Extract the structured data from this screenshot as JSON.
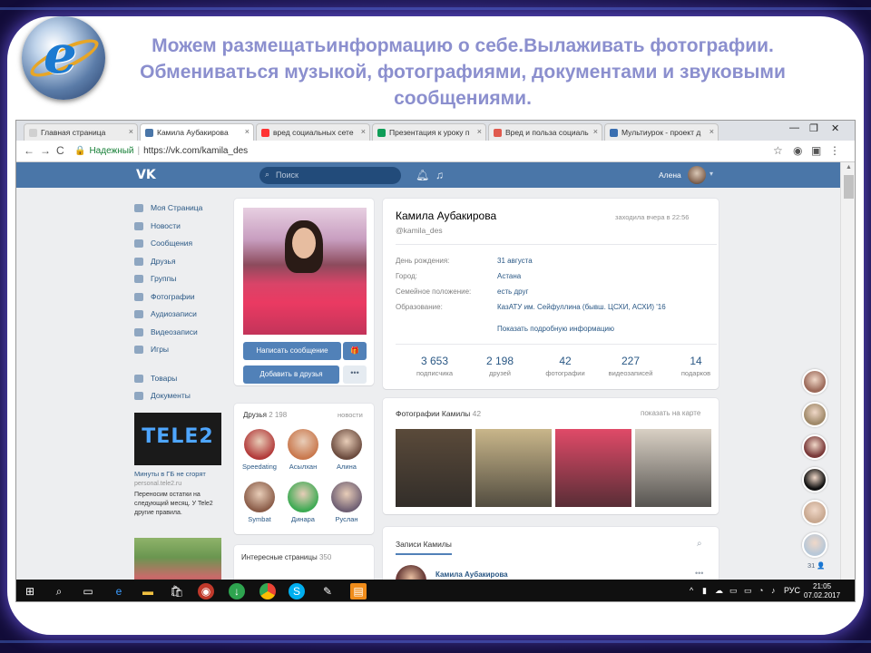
{
  "slide": {
    "title": "Можем размещатьинформацию о себе.Вылаживать фотографии. Обмениваться музыкой, фотографиями, документами и звуковыми сообщениями."
  },
  "browser": {
    "tabs": [
      {
        "label": "Главная страница",
        "active": false,
        "color": "#d0d0d0"
      },
      {
        "label": "Камила Аубакирова",
        "active": true,
        "color": "#4a76a8"
      },
      {
        "label": "вред социальных сете",
        "active": false,
        "color": "#f33"
      },
      {
        "label": "Презентация к уроку п",
        "active": false,
        "color": "#0f9d58"
      },
      {
        "label": "Вред и польза социаль",
        "active": false,
        "color": "#e05a4e"
      },
      {
        "label": "Мультиурок - проект д",
        "active": false,
        "color": "#3a6fb0"
      }
    ],
    "tab_close": "×",
    "window_controls": [
      "—",
      "❐",
      "✕"
    ],
    "nav": {
      "back": "←",
      "forward": "→",
      "reload": "C"
    },
    "secure_label": "Надежный",
    "url": "https://vk.com/kamila_des"
  },
  "vk": {
    "logo": "VK",
    "search_placeholder": "Поиск",
    "user_name": "Алена",
    "menu": [
      "Моя Страница",
      "Новости",
      "Сообщения",
      "Друзья",
      "Группы",
      "Фотографии",
      "Аудиозаписи",
      "Видеозаписи",
      "Игры"
    ],
    "menu2": [
      "Товары",
      "Документы"
    ],
    "ad": {
      "image_text": "TELE2",
      "title": "Минуты в ГБ не сгорят",
      "site": "personal.tele2.ru",
      "text": "Переносим остатки на следующий месяц. У Tele2 другие правила."
    },
    "profile": {
      "name": "Камила Аубакирова",
      "handle": "@kamila_des",
      "online": "заходила вчера в 22:56",
      "info": [
        {
          "key": "День рождения:",
          "value": "31 августа"
        },
        {
          "key": "Город:",
          "value": "Астана"
        },
        {
          "key": "Семейное положение:",
          "value": "есть друг"
        },
        {
          "key": "Образование:",
          "value": "КазАТУ им. Сейфуллина (бывш. ЦСХИ, АСХИ) '16"
        }
      ],
      "more_info": "Показать подробную информацию",
      "stats": [
        {
          "value": "3 653",
          "label": "подписчика"
        },
        {
          "value": "2 198",
          "label": "друзей"
        },
        {
          "value": "42",
          "label": "фотографии"
        },
        {
          "value": "227",
          "label": "видеозаписей"
        },
        {
          "value": "14",
          "label": "подарков"
        }
      ],
      "buttons": {
        "message": "Написать сообщение",
        "add_friend": "Добавить в друзья",
        "gift": "🎁",
        "more": "•••"
      }
    },
    "friends": {
      "title": "Друзья",
      "count": "2 198",
      "right": "новости",
      "items": [
        {
          "name": "Speedating",
          "color": "#b23a3a"
        },
        {
          "name": "Асылхан",
          "color": "#c9784d"
        },
        {
          "name": "Алина",
          "color": "#6b4b3e"
        },
        {
          "name": "Symbat",
          "color": "#8a5c48"
        },
        {
          "name": "Динара",
          "color": "#3caa52"
        },
        {
          "name": "Руслан",
          "color": "#6f5f73"
        }
      ]
    },
    "interesting": {
      "title": "Интересные страницы",
      "count": "350"
    },
    "photos": {
      "title": "Фотографии Камилы",
      "count": "42",
      "right": "показать на карте",
      "colors": [
        "#5a4a3a",
        "#c9b68a",
        "#e04a68",
        "#d9d0c4"
      ]
    },
    "wall": {
      "tab": "Записи Камилы",
      "post_author": "Камила Аубакирова",
      "post_more": "•••",
      "search_icon": "⌕"
    },
    "right_bubbles": {
      "count": "31",
      "colors": [
        "#9c6a5a",
        "#a08a6a",
        "#7a3a3a",
        "#111111",
        "#c8a890",
        "#b8c8d8"
      ]
    }
  },
  "taskbar": {
    "lang": "РУС",
    "time": "21:05",
    "date": "07.02.2017"
  }
}
